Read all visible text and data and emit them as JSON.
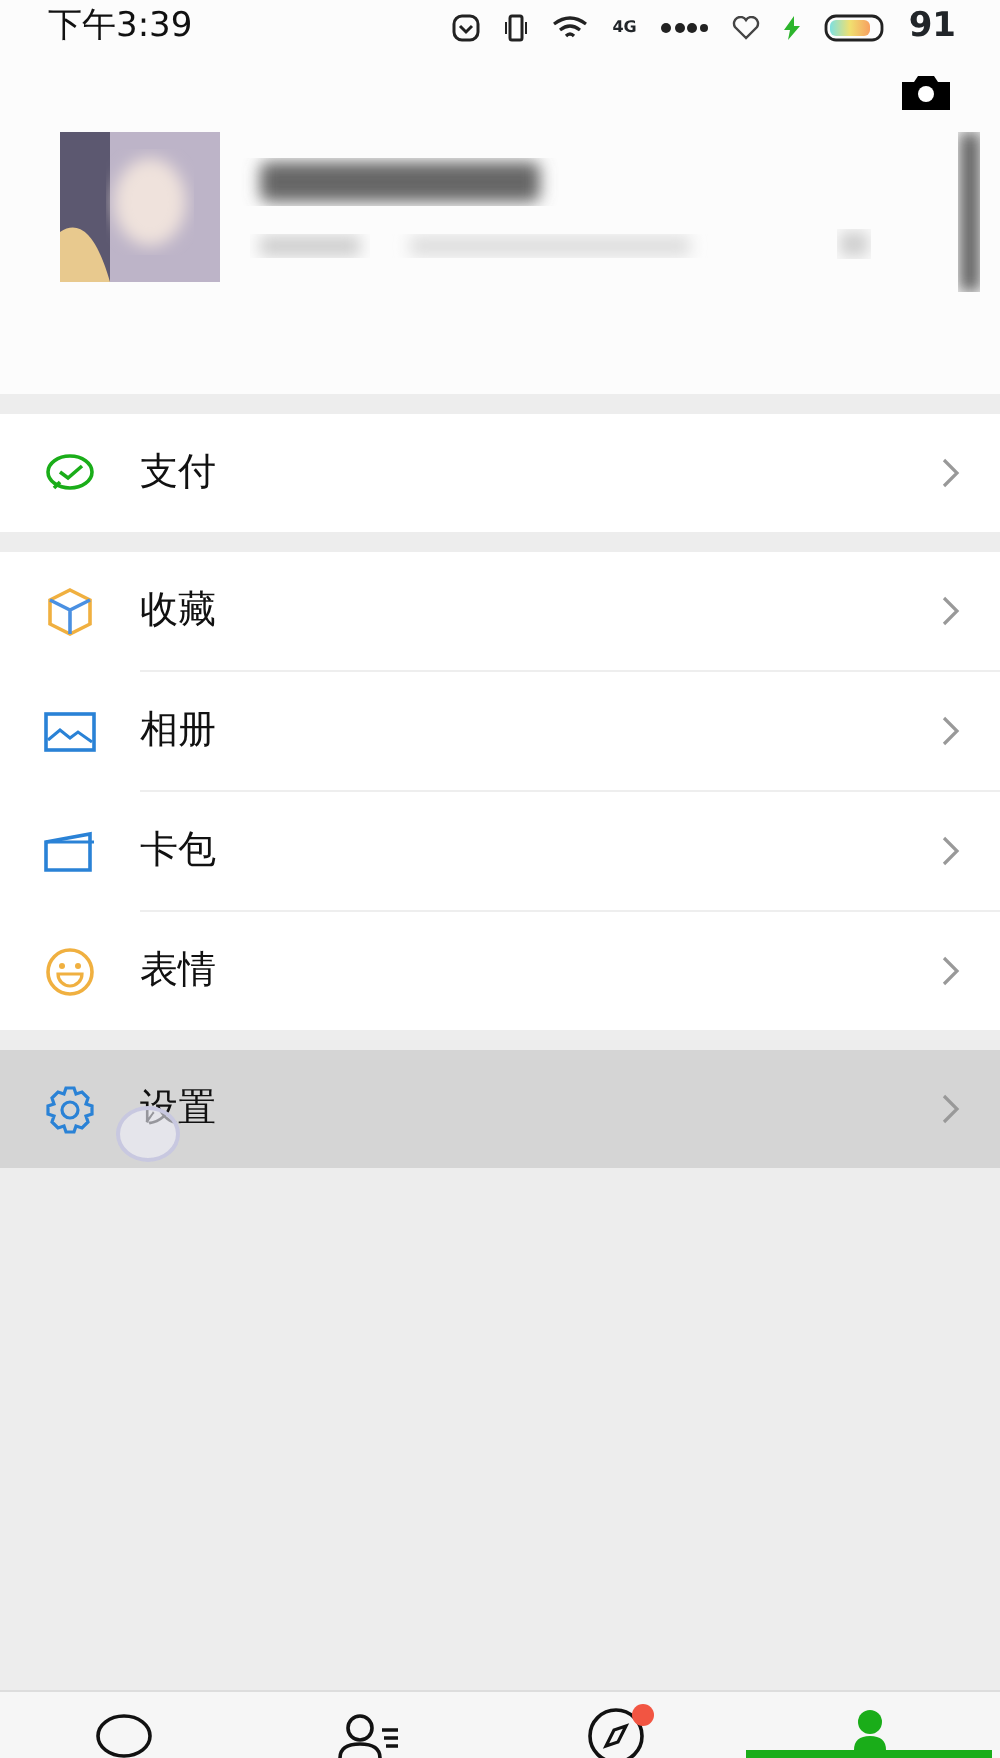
{
  "status_bar": {
    "time": "下午3:39",
    "network": "4G",
    "battery": "91"
  },
  "sections": [
    [
      {
        "label": "支付",
        "selected": false
      }
    ],
    [
      {
        "label": "收藏",
        "selected": false
      },
      {
        "label": "相册",
        "selected": false
      },
      {
        "label": "卡包",
        "selected": false
      },
      {
        "label": "表情",
        "selected": false
      }
    ],
    [
      {
        "label": "设置",
        "selected": true
      }
    ]
  ],
  "tab_bar": [
    {
      "selected": false,
      "badge": false
    },
    {
      "selected": false,
      "badge": false
    },
    {
      "selected": false,
      "badge": true
    },
    {
      "selected": true,
      "badge": false
    }
  ]
}
